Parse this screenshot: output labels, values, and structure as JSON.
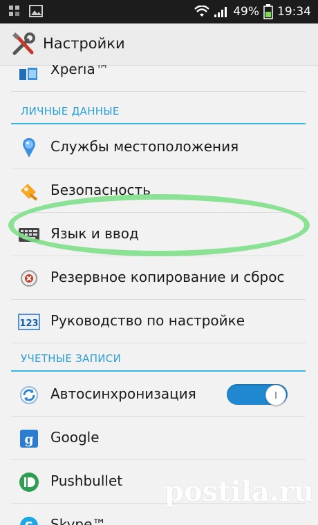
{
  "status_bar": {
    "battery_percent": "49%",
    "time": "19:34"
  },
  "action_bar": {
    "title": "Настройки"
  },
  "items": {
    "xperia": "Xperia™",
    "location": "Службы местоположения",
    "security": "Безопасность",
    "language": "Язык и ввод",
    "backup": "Резервное копирование и сброс",
    "guide": "Руководство по настройке",
    "autosync": "Автосинхронизация",
    "google": "Google",
    "pushbullet": "Pushbullet",
    "skype": "Skype™"
  },
  "sections": {
    "personal": "ЛИЧНЫЕ ДАННЫЕ",
    "accounts": "УЧЕТНЫЕ ЗАПИСИ"
  },
  "toggles": {
    "autosync_on": true
  },
  "icons": {
    "app": "settings-wrench-icon",
    "xperia": "xperia-icon",
    "location": "location-pin-icon",
    "security": "security-lock-icon",
    "language": "keyboard-icon",
    "backup": "backup-reset-icon",
    "guide": "123-guide-icon",
    "autosync": "sync-icon",
    "google": "google-icon",
    "pushbullet": "pushbullet-icon",
    "skype": "skype-icon"
  },
  "colors": {
    "accent": "#33b5e5",
    "toggle_on": "#1f88d0",
    "highlight": "#7fe08a"
  },
  "watermark": "postila.ru"
}
